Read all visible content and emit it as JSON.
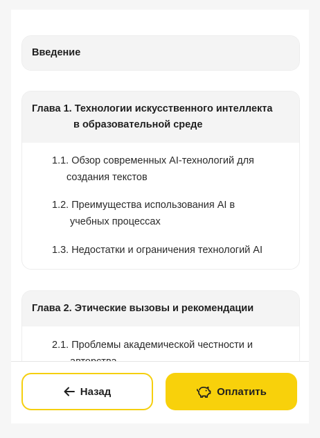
{
  "intro": {
    "title": "Введение"
  },
  "chapter1": {
    "title_line1": "Глава 1. Технологии искусственного интеллекта",
    "title_line2": "в образовательной среде",
    "items": [
      {
        "line1": "1.1. Обзор современных AI-технологий для",
        "line2": "создания текстов"
      },
      {
        "line1": "1.2. Преимущества использования AI в",
        "line2": "учебных процессах"
      },
      {
        "line1": "1.3. Недостатки и ограничения технологий AI",
        "line2": ""
      }
    ]
  },
  "chapter2": {
    "title": "Глава 2. Этические вызовы и рекомендации",
    "items": [
      {
        "line1": "2.1. Проблемы академической честности и",
        "line2": "авторства"
      }
    ]
  },
  "footer": {
    "back_label": "Назад",
    "pay_label": "Оплатить",
    "back_icon": "arrow-left-icon",
    "pay_icon": "piggy-bank-icon"
  },
  "colors": {
    "accent": "#f8d10b",
    "accent_border": "#f5cf0f"
  }
}
